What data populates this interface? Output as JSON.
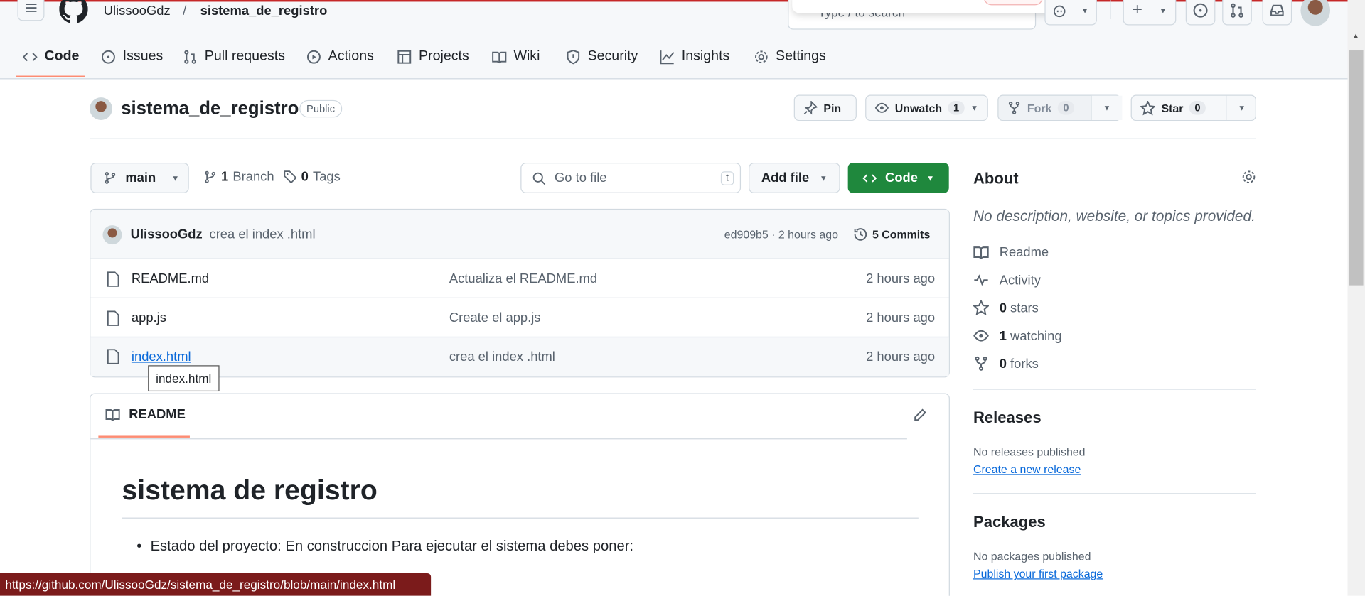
{
  "header": {
    "owner": "UlissooGdz",
    "separator": "/",
    "repo": "sistema_de_registro",
    "search_placeholder": "Type / to search"
  },
  "tabs": [
    {
      "label": "Code",
      "icon": "code-icon"
    },
    {
      "label": "Issues",
      "icon": "issue-icon"
    },
    {
      "label": "Pull requests",
      "icon": "pull-request-icon"
    },
    {
      "label": "Actions",
      "icon": "play-icon"
    },
    {
      "label": "Projects",
      "icon": "table-icon"
    },
    {
      "label": "Wiki",
      "icon": "book-icon"
    },
    {
      "label": "Security",
      "icon": "shield-icon"
    },
    {
      "label": "Insights",
      "icon": "graph-icon"
    },
    {
      "label": "Settings",
      "icon": "gear-icon"
    }
  ],
  "repo": {
    "name": "sistema_de_registro",
    "visibility": "Public",
    "pin": "Pin",
    "unwatch": "Unwatch",
    "watch_count": "1",
    "fork": "Fork",
    "fork_count": "0",
    "star": "Star",
    "star_count": "0"
  },
  "toolbar": {
    "branch": "main",
    "branches_count": "1",
    "branches_label": "Branch",
    "tags_count": "0",
    "tags_label": "Tags",
    "goto_placeholder": "Go to file",
    "goto_key": "t",
    "add_file": "Add file",
    "code": "Code"
  },
  "commit": {
    "author": "UlissooGdz",
    "message": "crea el index .html",
    "hash_time": "ed909b5 · 2 hours ago",
    "commits": "5 Commits"
  },
  "files": [
    {
      "name": "README.md",
      "message": "Actualiza el README.md",
      "time": "2 hours ago"
    },
    {
      "name": "app.js",
      "message": "Create el app.js",
      "time": "2 hours ago"
    },
    {
      "name": "index.html",
      "message": "crea el index .html",
      "time": "2 hours ago"
    }
  ],
  "tooltip": "index.html",
  "readme": {
    "tab": "README",
    "title": "sistema de registro",
    "bullet": "Estado del proyecto: En construccion Para ejecutar el sistema debes poner:"
  },
  "about": {
    "title": "About",
    "description": "No description, website, or topics provided.",
    "items": [
      {
        "icon": "book-icon",
        "label": "Readme"
      },
      {
        "icon": "pulse-icon",
        "label": "Activity"
      },
      {
        "icon": "star-icon",
        "count": "0",
        "label": "stars"
      },
      {
        "icon": "eye-icon",
        "count": "1",
        "label": "watching"
      },
      {
        "icon": "fork-icon",
        "count": "0",
        "label": "forks"
      }
    ]
  },
  "releases": {
    "title": "Releases",
    "text": "No releases published",
    "link": "Create a new release"
  },
  "packages": {
    "title": "Packages",
    "text": "No packages published",
    "link": "Publish your first package"
  },
  "status_url": "https://github.com/UlissooGdz/sistema_de_registro/blob/main/index.html",
  "colors": {
    "accent_green": "#1f883d",
    "link": "#0969da",
    "tab_underline": "#fd8c73",
    "status_bar": "#7b1b1b"
  }
}
